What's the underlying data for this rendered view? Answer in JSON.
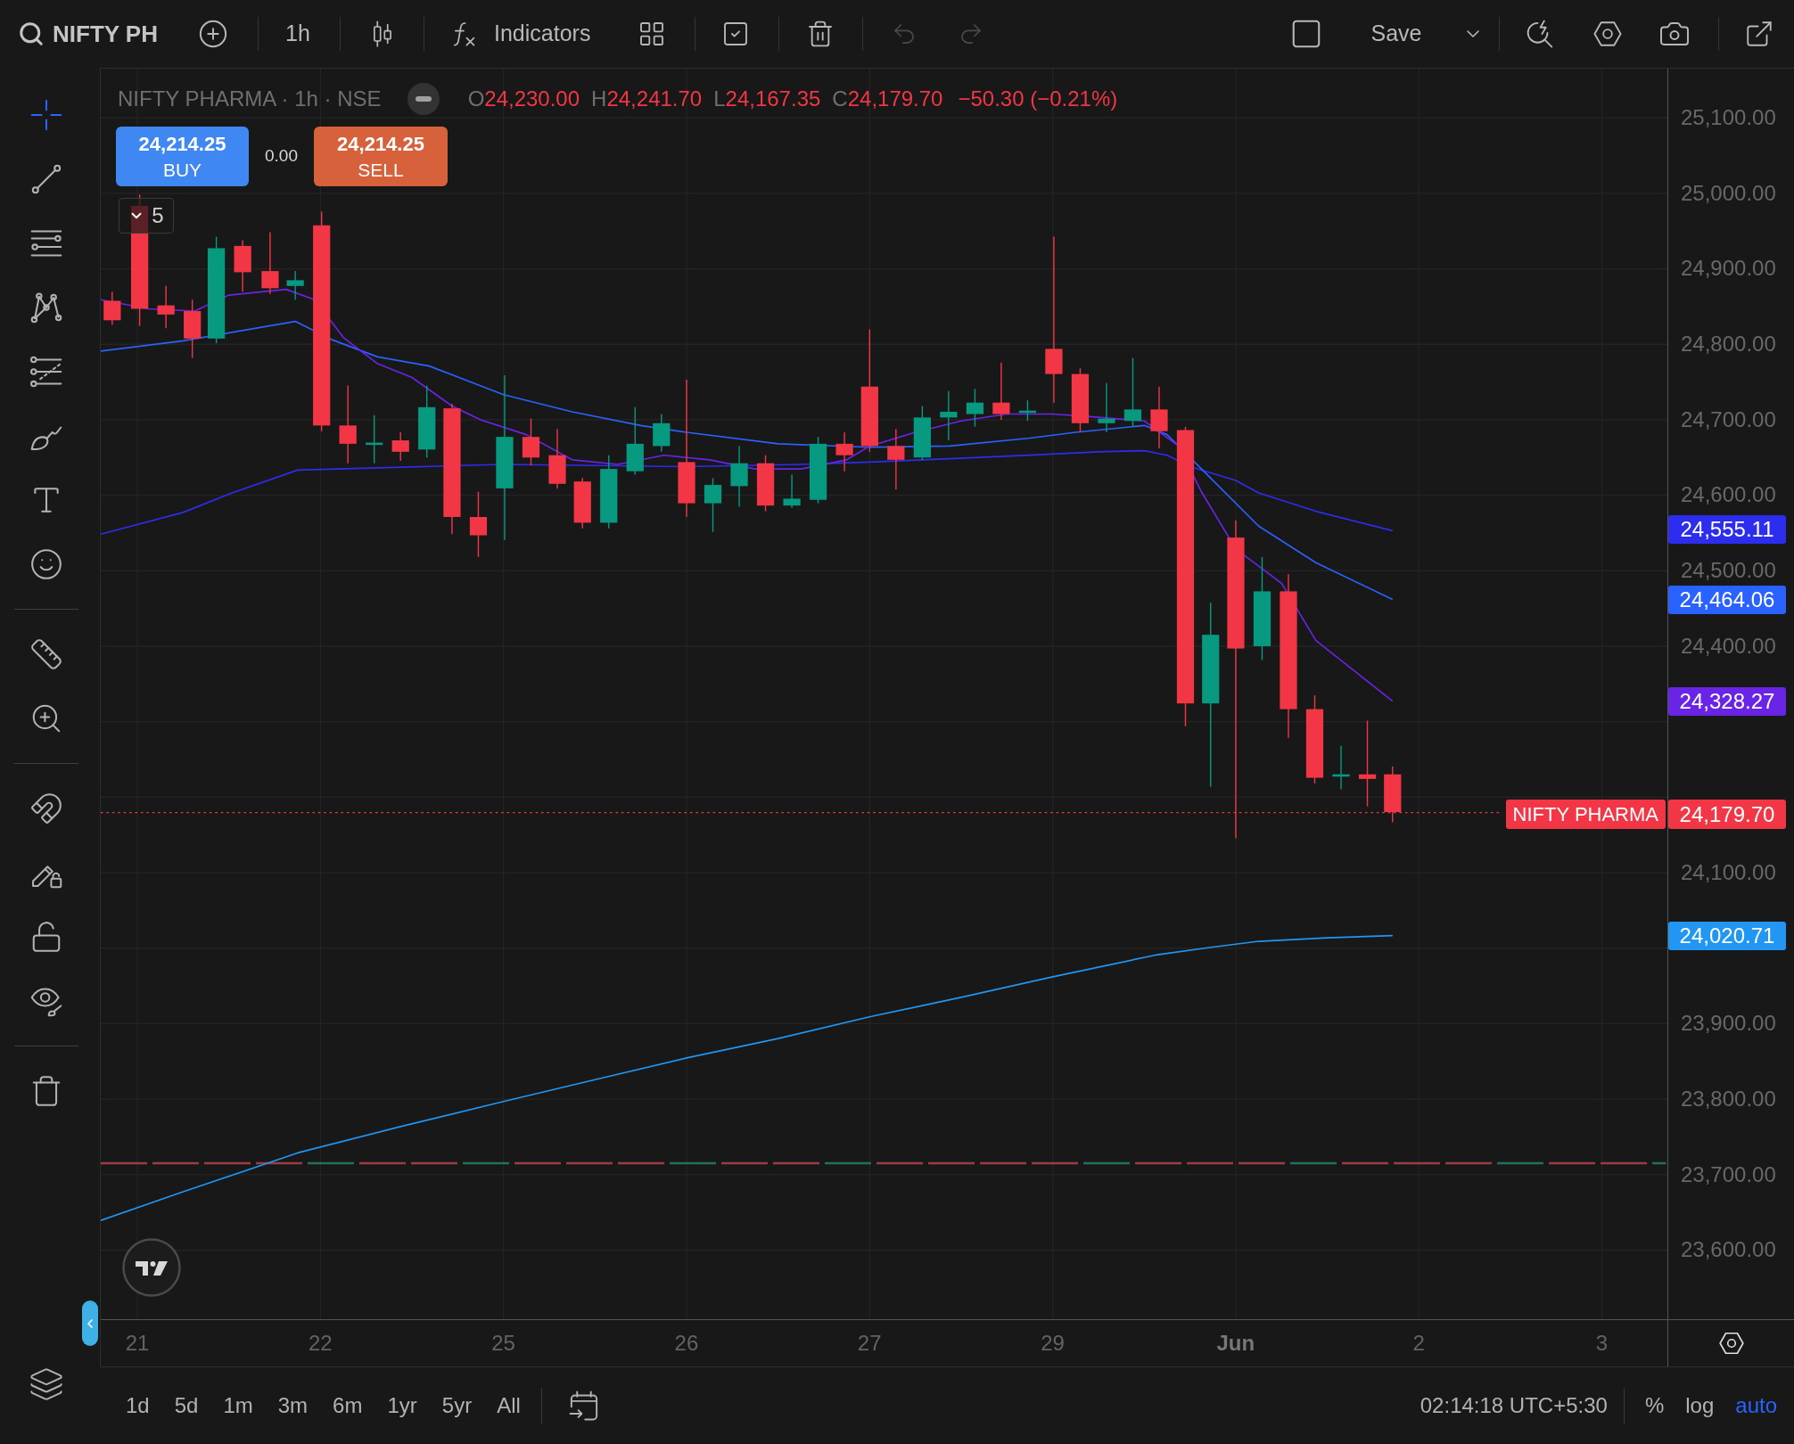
{
  "toolbar": {
    "symbol": "NIFTY PH",
    "interval": "1h",
    "indicators": "Indicators",
    "save": "Save",
    "undo": {
      "disabled": true
    },
    "redo": {
      "disabled": true
    }
  },
  "drawing_tools": [
    {
      "selected": true
    },
    {
      "selected": false
    },
    {
      "selected": false
    },
    {
      "selected": false
    },
    {
      "selected": false
    },
    {
      "selected": false
    },
    {
      "selected": false
    },
    {
      "selected": false
    },
    {
      "selected": false
    },
    {
      "selected": false
    },
    {
      "selected": false
    },
    {
      "selected": false
    },
    {
      "selected": false
    },
    {
      "selected": false
    },
    {
      "selected": false
    }
  ],
  "legend": {
    "title": "NIFTY PHARMA · 1h · NSE",
    "falling": true,
    "ohlc": [
      {
        "label": "O",
        "value": "24,230.00"
      },
      {
        "label": "H",
        "value": "24,241.70"
      },
      {
        "label": "L",
        "value": "24,167.35"
      },
      {
        "label": "C",
        "value": "24,179.70"
      }
    ],
    "change": "−50.30 (−0.21%)"
  },
  "order_panel": {
    "buy": {
      "price": "24,214.25",
      "label": "BUY"
    },
    "spread": "0.00",
    "sell": {
      "price": "24,214.25",
      "label": "SELL"
    }
  },
  "indicators_toggle": {
    "count": "5"
  },
  "price_axis": {
    "ticks": [
      "25,100.00",
      "25,000.00",
      "24,900.00",
      "24,800.00",
      "24,700.00",
      "24,600.00",
      "24,500.00",
      "24,400.00",
      "24,100.00",
      "23,900.00",
      "23,800.00",
      "23,700.00",
      "23,600.00"
    ],
    "markers": [
      {
        "value": "24,555.11",
        "color": "#2d2df0"
      },
      {
        "value": "24,464.06",
        "color": "#2962ff"
      },
      {
        "value": "24,328.27",
        "color": "#6a24e6"
      },
      {
        "value": "24,020.71",
        "color": "#2196f3"
      }
    ],
    "last_price": {
      "symbol": "NIFTY PHARMA",
      "value": "24,179.70"
    }
  },
  "time_axis": {
    "ticks": [
      {
        "label": "21",
        "kind": "day"
      },
      {
        "label": "22",
        "kind": "day"
      },
      {
        "label": "25",
        "kind": "day"
      },
      {
        "label": "26",
        "kind": "day"
      },
      {
        "label": "27",
        "kind": "day"
      },
      {
        "label": "29",
        "kind": "day"
      },
      {
        "label": "Jun",
        "kind": "month"
      },
      {
        "label": "2",
        "kind": "day"
      },
      {
        "label": "3",
        "kind": "day"
      }
    ]
  },
  "bottom_bar": {
    "ranges": [
      "1d",
      "5d",
      "1m",
      "3m",
      "6m",
      "1yr",
      "5yr",
      "All"
    ],
    "clock": "02:14:18 UTC+5:30",
    "scale_options": [
      {
        "label": "%",
        "on": false
      },
      {
        "label": "log",
        "on": false
      },
      {
        "label": "auto",
        "on": true
      }
    ]
  }
}
